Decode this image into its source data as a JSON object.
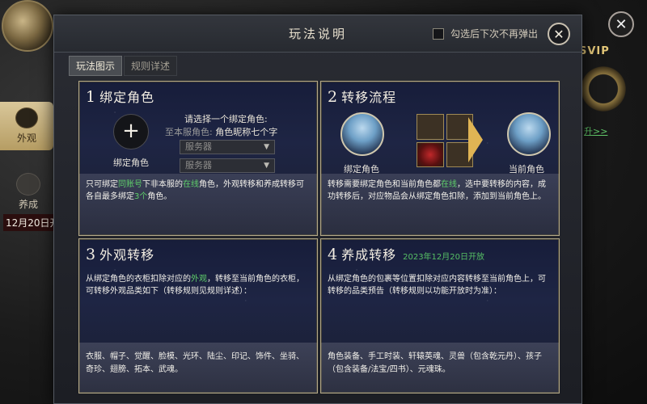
{
  "background": {
    "side_tab_label": "外观",
    "side_tab2_label": "养成",
    "side_date": "12月20日开",
    "svip_label": "SVIP",
    "svip_link": "升>>"
  },
  "dialog": {
    "title": "玩法说明",
    "checkbox_label": "勾选后下次不再弹出",
    "close_glyph": "✕",
    "tabs": [
      {
        "label": "玩法图示",
        "active": true
      },
      {
        "label": "规则详述",
        "active": false
      }
    ]
  },
  "panel1": {
    "num": "1",
    "title": "绑定角色",
    "add_glyph": "+",
    "add_label": "绑定角色",
    "prompt": "请选择一个绑定角色:",
    "current_label": "至本服角色:",
    "current_value": "角色昵称七个字",
    "select1": "服务器",
    "select2": "服务器",
    "desc_a": "只可绑定",
    "desc_hl1": "同账号",
    "desc_b": "下非本服的",
    "desc_hl2": "在线",
    "desc_c": "角色，外观转移和养成转移可各自最多绑定",
    "desc_hl3": "3个",
    "desc_d": "角色。"
  },
  "panel2": {
    "num": "2",
    "title": "转移流程",
    "left_label": "绑定角色",
    "right_label": "当前角色",
    "desc_a": "转移需要绑定角色和当前角色都",
    "desc_hl1": "在线",
    "desc_b": "，选中要转移的内容，成功转移后，对应物品会从绑定角色扣除，添加到当前角色上。"
  },
  "panel3": {
    "num": "3",
    "title": "外观转移",
    "desc_a": "从绑定角色的衣柜扣除对应的",
    "desc_hl1": "外观",
    "desc_b": "，转移至当前角色的衣柜，可转移外观品类如下（转移规则见规则详述）：",
    "foot": "衣服、帽子、觉醒、脸模、光环、陆尘、印记、饰件、坐骑、奇珍、翅膀、拓本、武魂。"
  },
  "panel4": {
    "num": "4",
    "title": "养成转移",
    "subtitle": "2023年12月20日开放",
    "desc": "从绑定角色的包裹等位置扣除对应内容转移至当前角色上，可转移的品类预告（转移规则以功能开放时为准）：",
    "foot": "角色装备、手工时装、轩辕英魂、灵兽（包含乾元丹）、孩子（包含装备/法宝/四书）、元魂珠。"
  },
  "colors": {
    "highlight": "#5fcf6a",
    "panel_border": "#b4a988",
    "accent_gold": "#e0b454"
  }
}
